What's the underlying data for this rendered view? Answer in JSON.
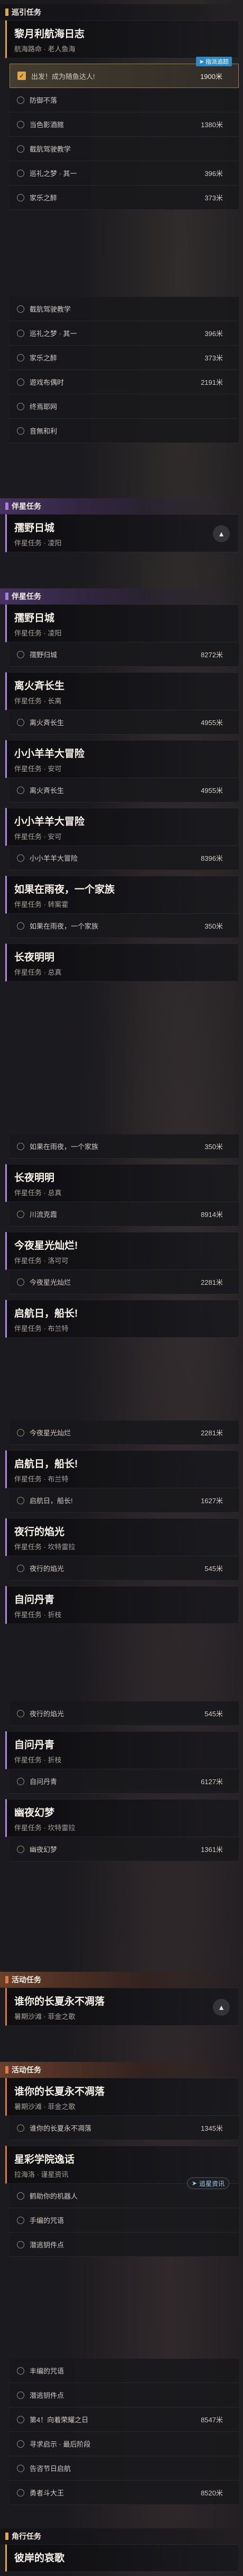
{
  "meta": {
    "page_size": "460x4860"
  },
  "daily": {
    "header": "巡引任务",
    "quest": {
      "title": "黎月利航海日志",
      "subtitle": "航海路命 · 老人鱼海"
    },
    "highlight_step": {
      "label": "出发！成为随鱼达人!",
      "distance": "1900米",
      "badge": "指派追踪"
    },
    "steps": [
      {
        "label": "防御不落",
        "distance": ""
      },
      {
        "label": "当色影酒館",
        "distance": "1380米"
      },
      {
        "label": "截肮驾驶教学",
        "distance": ""
      },
      {
        "label": "巡礼之梦 · 其一",
        "distance": "396米"
      },
      {
        "label": "家乐之醉",
        "distance": "373米"
      }
    ],
    "steps_repeat": [
      {
        "label": "截肮驾驶教学",
        "distance": ""
      },
      {
        "label": "巡礼之梦 · 其一",
        "distance": "396米"
      },
      {
        "label": "家乐之醉",
        "distance": "373米"
      },
      {
        "label": "遊戏布偶时",
        "distance": "2191米"
      },
      {
        "label": "终焉耶网",
        "distance": ""
      },
      {
        "label": "音無和利",
        "distance": ""
      }
    ]
  },
  "companion": {
    "header": "伴星任务",
    "quests": [
      {
        "title": "孺野日城",
        "subtitle": "伴星任务 · 凌阳",
        "step": "孺野归城",
        "distance": "8272米"
      },
      {
        "title": "离火斉长生",
        "subtitle": "伴星任务 · 长离",
        "step": "离火斉长生",
        "distance": "4955米"
      },
      {
        "title": "小小羊羊大冒险",
        "subtitle": "伴星任务 · 安可",
        "step": "小小羊羊大冒险",
        "distance": "8396米"
      },
      {
        "title": "如果在雨夜，一个家族",
        "subtitle": "伴星任务 · 转案霍",
        "step": "如果在雨夜，一个家族",
        "distance": "350米"
      },
      {
        "title": "长夜明明",
        "subtitle": "伴星任务 · 总真",
        "step": "川流克霞",
        "distance": "8914米"
      },
      {
        "title": "今夜星光灿烂!",
        "subtitle": "伴星任务 · 洛可可",
        "step": "今夜星光灿烂",
        "distance": "2281米"
      },
      {
        "title": "启航日，船长!",
        "subtitle": "伴星任务 · 布兰特",
        "step": "启航日，船长!",
        "distance": "1627米"
      },
      {
        "title": "夜行的焰光",
        "subtitle": "伴星任务 · 坎特雷拉",
        "step": "夜行的焰光",
        "distance": "545米"
      },
      {
        "title": "自问丹青",
        "subtitle": "伴星任务 · 折枝",
        "step": "自问丹青",
        "distance": "6127米"
      },
      {
        "title": "幽夜幻梦",
        "subtitle": "伴星任务 · 坎特雷拉",
        "step": "幽夜幻梦",
        "distance": "1361米"
      }
    ]
  },
  "event": {
    "header": "活动任务",
    "quests": [
      {
        "title": "谁你的长夏永不凋落",
        "subtitle": "暑期沙滩 · 菲金之歌",
        "step": "谁你的长夏永不凋落",
        "distance": "1345米"
      },
      {
        "title": "星彩学院逸话",
        "subtitle": "拉海洛 · 谨星资讯",
        "steps": [
          "鹤助你的机器人",
          "手编的咒语",
          "潜逃钥件点"
        ],
        "badge": "追星资讯"
      }
    ],
    "tail_steps": [
      {
        "label": "丰编的咒语",
        "distance": ""
      },
      {
        "label": "潜逃钥件点",
        "distance": ""
      },
      {
        "label": "第4！向着荣耀之日",
        "distance": "8547米"
      },
      {
        "label": "寻求启示 · 最后阶段",
        "distance": ""
      },
      {
        "label": "告咨节日启航",
        "distance": ""
      },
      {
        "label": "勇者斗大王",
        "distance": "8520米"
      }
    ]
  },
  "adventure": {
    "header": "角行任务",
    "quest_title": "彼岸的哀歌"
  }
}
